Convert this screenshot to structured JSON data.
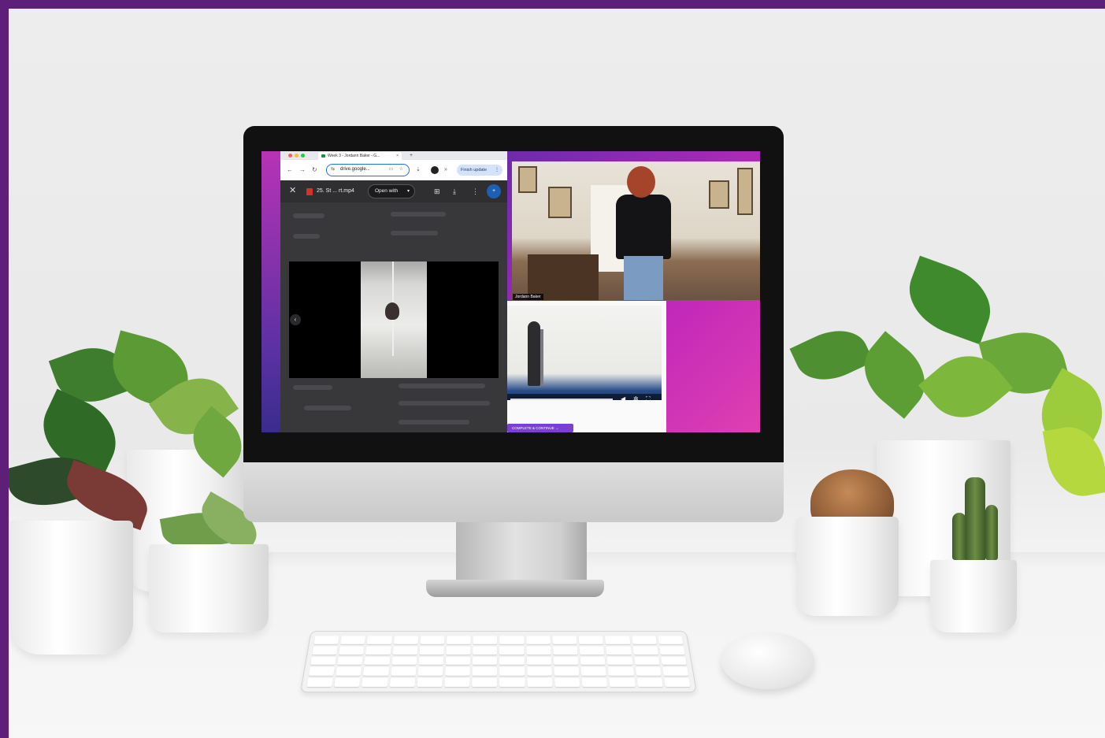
{
  "browser": {
    "tab_title": "Week 3 - Jordann Baker - G...",
    "tab_close": "×",
    "tab_add": "+",
    "url": "drive.google...",
    "finish_update": "Finish update",
    "menu_dots": "⋮"
  },
  "drive_viewer": {
    "close": "✕",
    "file_name": "25. St ... rt.mp4",
    "open_with": "Open with",
    "caret": "▾",
    "prev": "‹"
  },
  "video_call": {
    "participant_name": "Jordann Baker"
  },
  "course": {
    "complete_button": "COMPLETE & CONTINUE →"
  },
  "icons": {
    "back": "←",
    "forward": "→",
    "reload": "↻",
    "site_info": "⇆",
    "cast": "▭",
    "bookmark": "☆",
    "tab_search": "⇣",
    "extensions": "»",
    "add_comment": "⊞",
    "download": "⤓",
    "more": "⋮",
    "share": "+",
    "mute": "◀",
    "settings": "✲",
    "fullscreen": "⛶"
  },
  "colors": {
    "frame": "#5e1f78",
    "accent_blue": "#1a73e8",
    "course_button": "#7b3fd6"
  }
}
